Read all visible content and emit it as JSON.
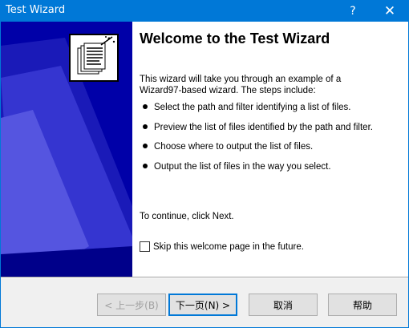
{
  "window": {
    "title": "Test Wizard",
    "help_glyph": "?",
    "close_glyph": "✕"
  },
  "welcome": {
    "heading": "Welcome to the Test Wizard",
    "intro": "This wizard will take you through an example of a Wizard97-based wizard.  The steps include:",
    "steps": [
      "Select the path and filter identifying a list of files.",
      "Preview the list of files identified by the path and filter.",
      "Choose where to output the list of files.",
      "Output the list of files in the way you select."
    ],
    "continue_text": "To continue, click Next.",
    "skip_label": "Skip this welcome page in the future.",
    "skip_checked": false
  },
  "buttons": {
    "back": "< 上一步(B)",
    "next": "下一页(N) >",
    "cancel": "取消",
    "help": "帮助"
  },
  "colors": {
    "titlebar": "#0078d7",
    "side_panel": "#0000a8",
    "side_shape": "#2a2acc"
  }
}
